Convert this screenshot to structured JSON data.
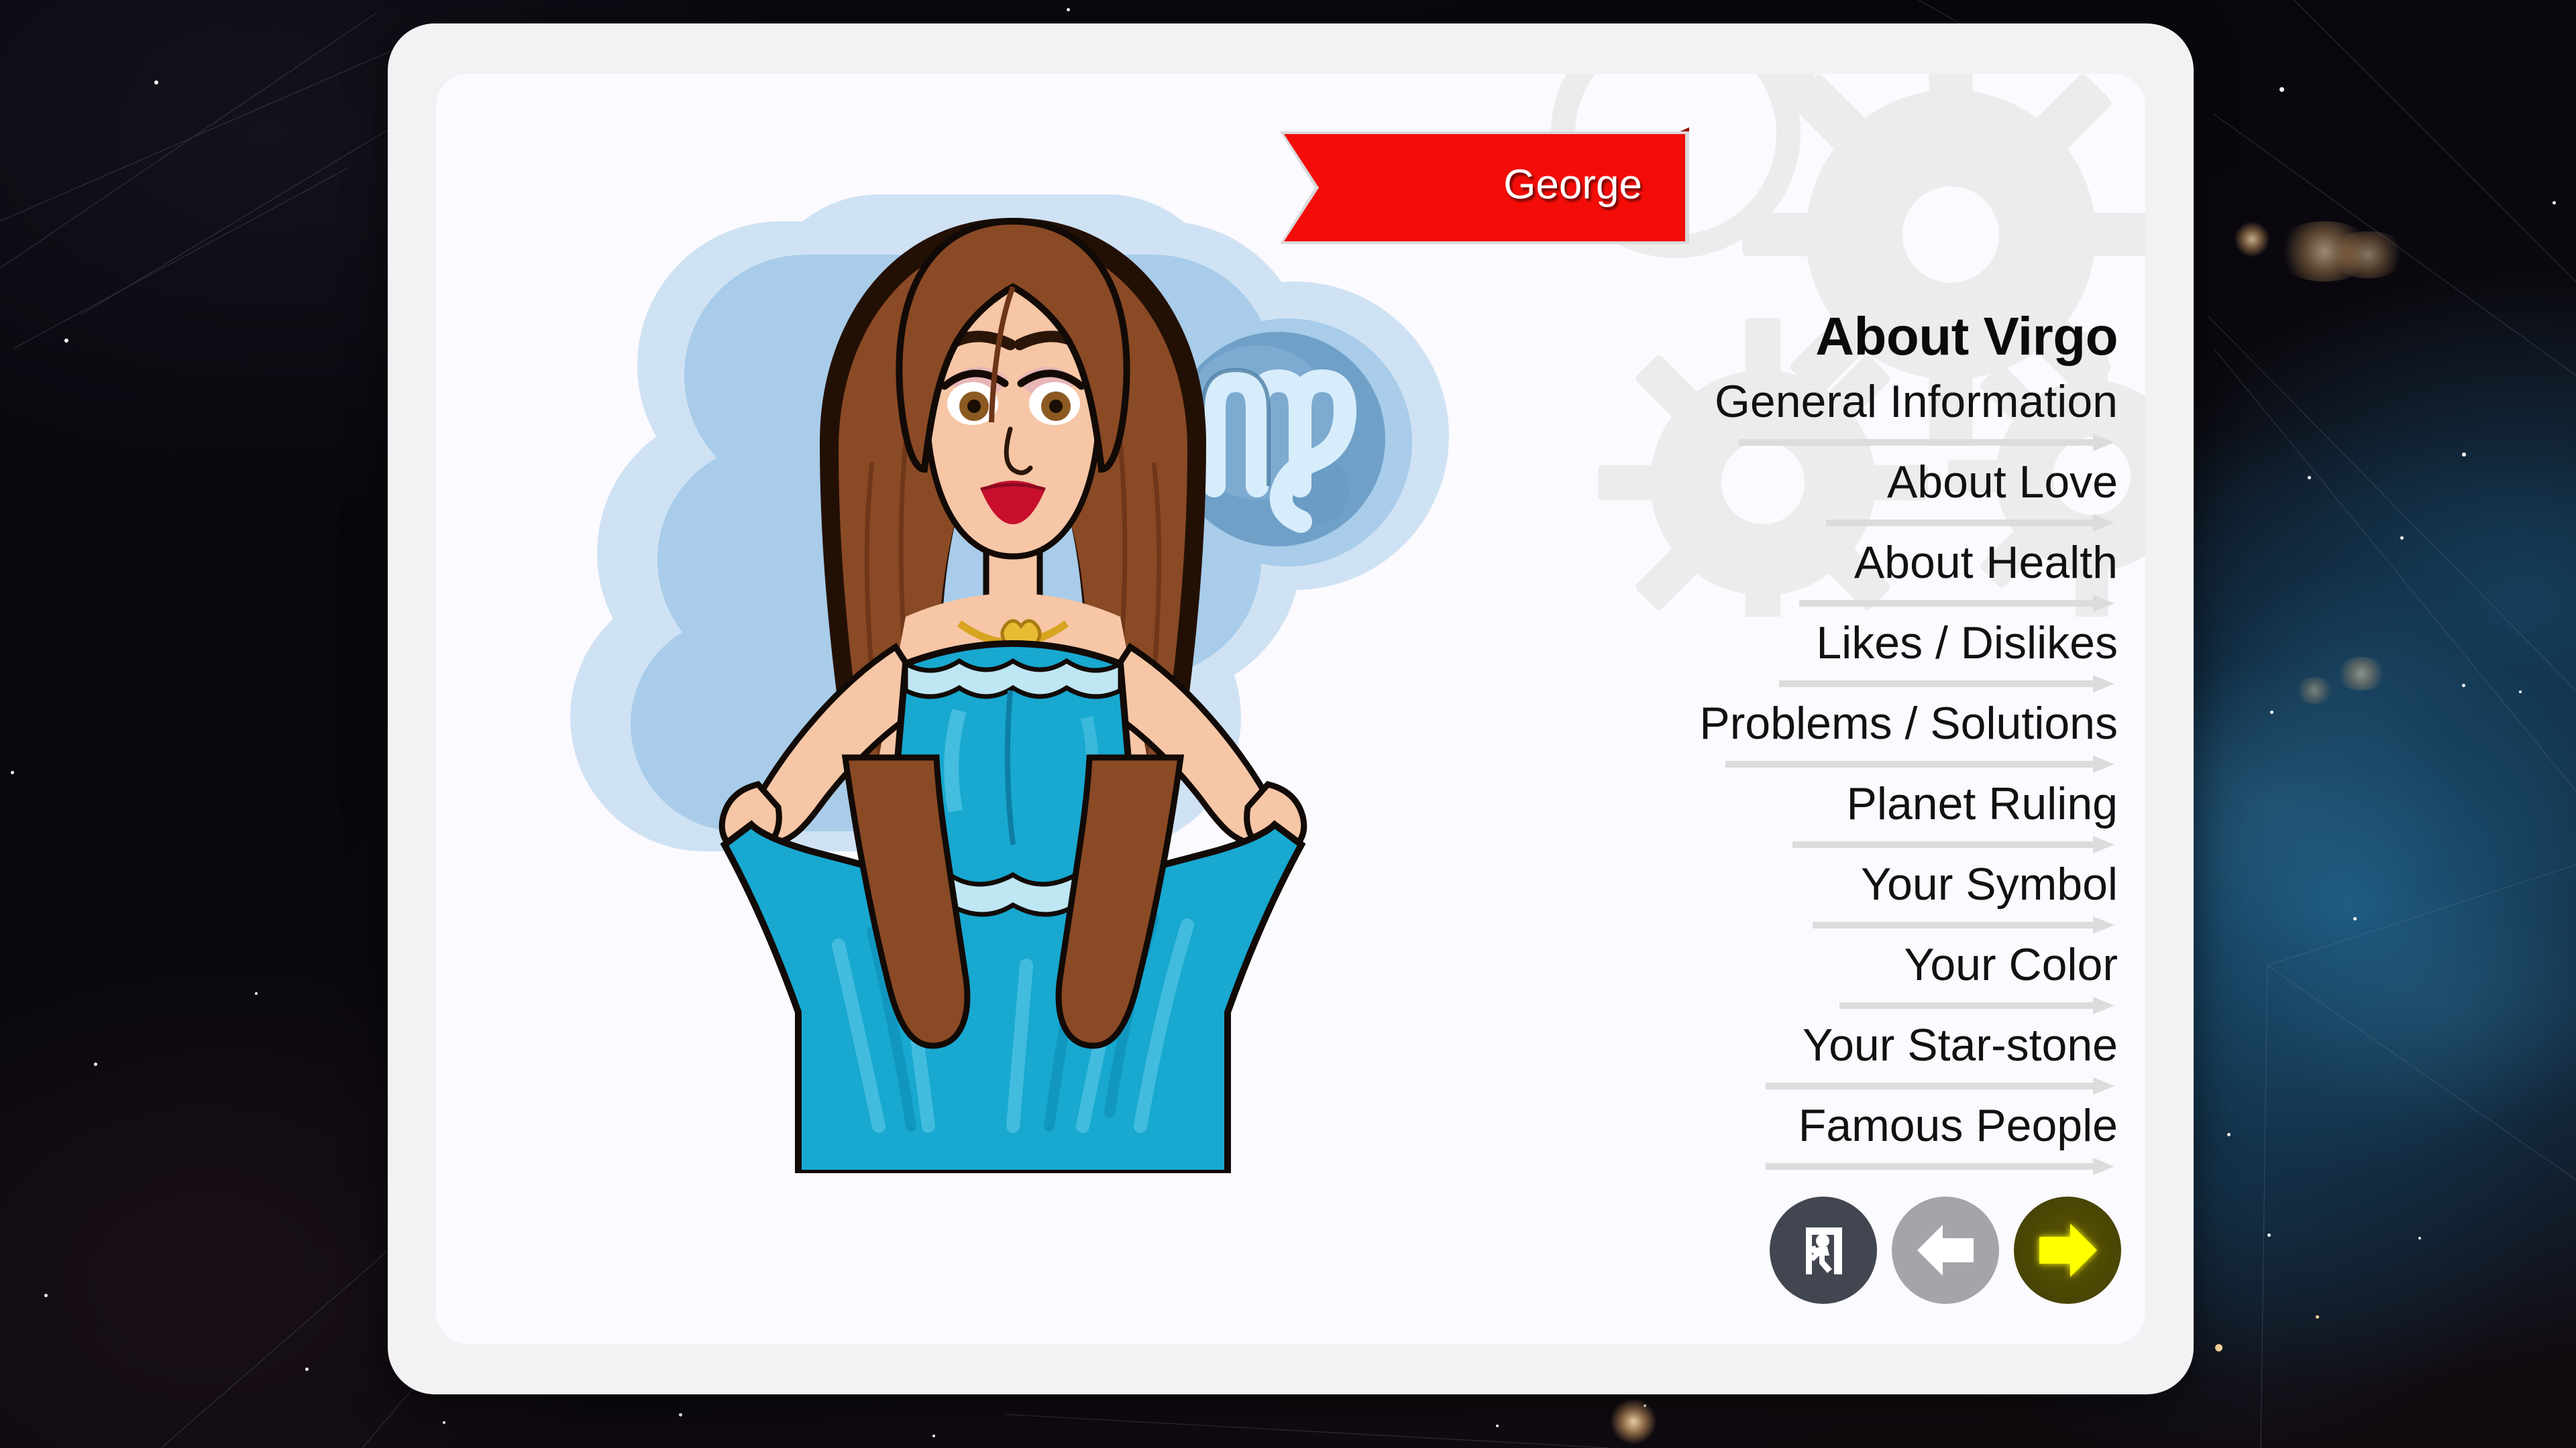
{
  "app": {
    "screen_name": "About Virgo",
    "zodiac_sign": "Virgo",
    "zodiac_symbol": "♍"
  },
  "ribbon": {
    "name": "George",
    "color": "#f40d08",
    "fold_color": "#9c0604",
    "text_color": "#ffffff"
  },
  "header": {
    "title": "About Virgo"
  },
  "menu": {
    "items": [
      {
        "label": "General Information"
      },
      {
        "label": "About Love"
      },
      {
        "label": "About Health"
      },
      {
        "label": "Likes / Dislikes"
      },
      {
        "label": "Problems / Solutions"
      },
      {
        "label": "Planet Ruling"
      },
      {
        "label": "Your Symbol"
      },
      {
        "label": "Your Color"
      },
      {
        "label": "Your Star-stone"
      },
      {
        "label": "Famous People"
      }
    ],
    "arrow_color": "#dcdcdc"
  },
  "illustration": {
    "description": "Cartoon Virgo woman with long wavy brown hair wearing a blue strapless gown, holding the skirt out at both sides, with a gold heart necklace",
    "zodiac_badge_symbol": "♍",
    "colors": {
      "blob_outer": "#cfe2f3",
      "blob_inner": "#a8cce9",
      "dress": "#18a8d0",
      "dress_shade": "#0d8cb4",
      "dress_light": "#53c4e4",
      "hair": "#8a4a25",
      "hair_dark": "#6e3518",
      "skin": "#f6c6a6",
      "badge_circle": "#6fa0c8",
      "badge_symbol": "#cfe8f7",
      "necklace": "#d8a520"
    }
  },
  "buttons": {
    "exit": {
      "label": "Exit",
      "icon": "exit-running-person-icon",
      "color": "#424650"
    },
    "back": {
      "label": "Back",
      "icon": "left-arrow-icon",
      "color": "#a3a5ab"
    },
    "forward": {
      "label": "Next",
      "icon": "right-arrow-icon",
      "color": "#4c4804",
      "arrow_color": "#ffff00"
    }
  },
  "card": {
    "frame_color": "#f2f2f4",
    "panel_color": "#fbfaff",
    "watermark": "gear-cog-watermark"
  },
  "background": {
    "theme": "starfield-nebula",
    "base_color": "#08070d",
    "nebula_color": "#1e5f87"
  }
}
